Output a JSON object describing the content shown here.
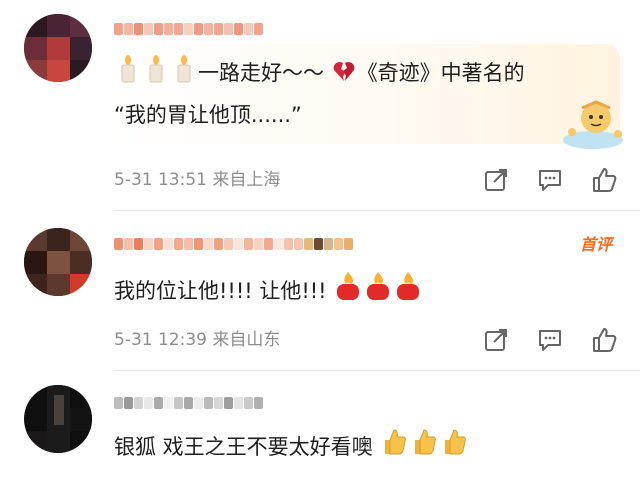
{
  "comments": [
    {
      "text_main": "一路走好～～",
      "text_after_heart": "《奇迹》中著名的",
      "text_line2": "“我的胃让他顶......”",
      "time": "5-31 13:51",
      "location": "来自上海"
    },
    {
      "text": "我的位让他!!!! 让他!!!",
      "badge": "首评",
      "time": "5-31 12:39",
      "location": "来自山东"
    },
    {
      "text": "银狐 戏王之王不要太好看噢"
    }
  ],
  "icons": [
    "candle-icon",
    "broken-heart-icon",
    "fire-icon",
    "thumbs-up-emoji",
    "share-icon",
    "comment-icon",
    "like-icon"
  ],
  "colors": {
    "meta": "#8d8d8d",
    "badge": "#ff6a1a",
    "divider": "#e8e8e8"
  }
}
